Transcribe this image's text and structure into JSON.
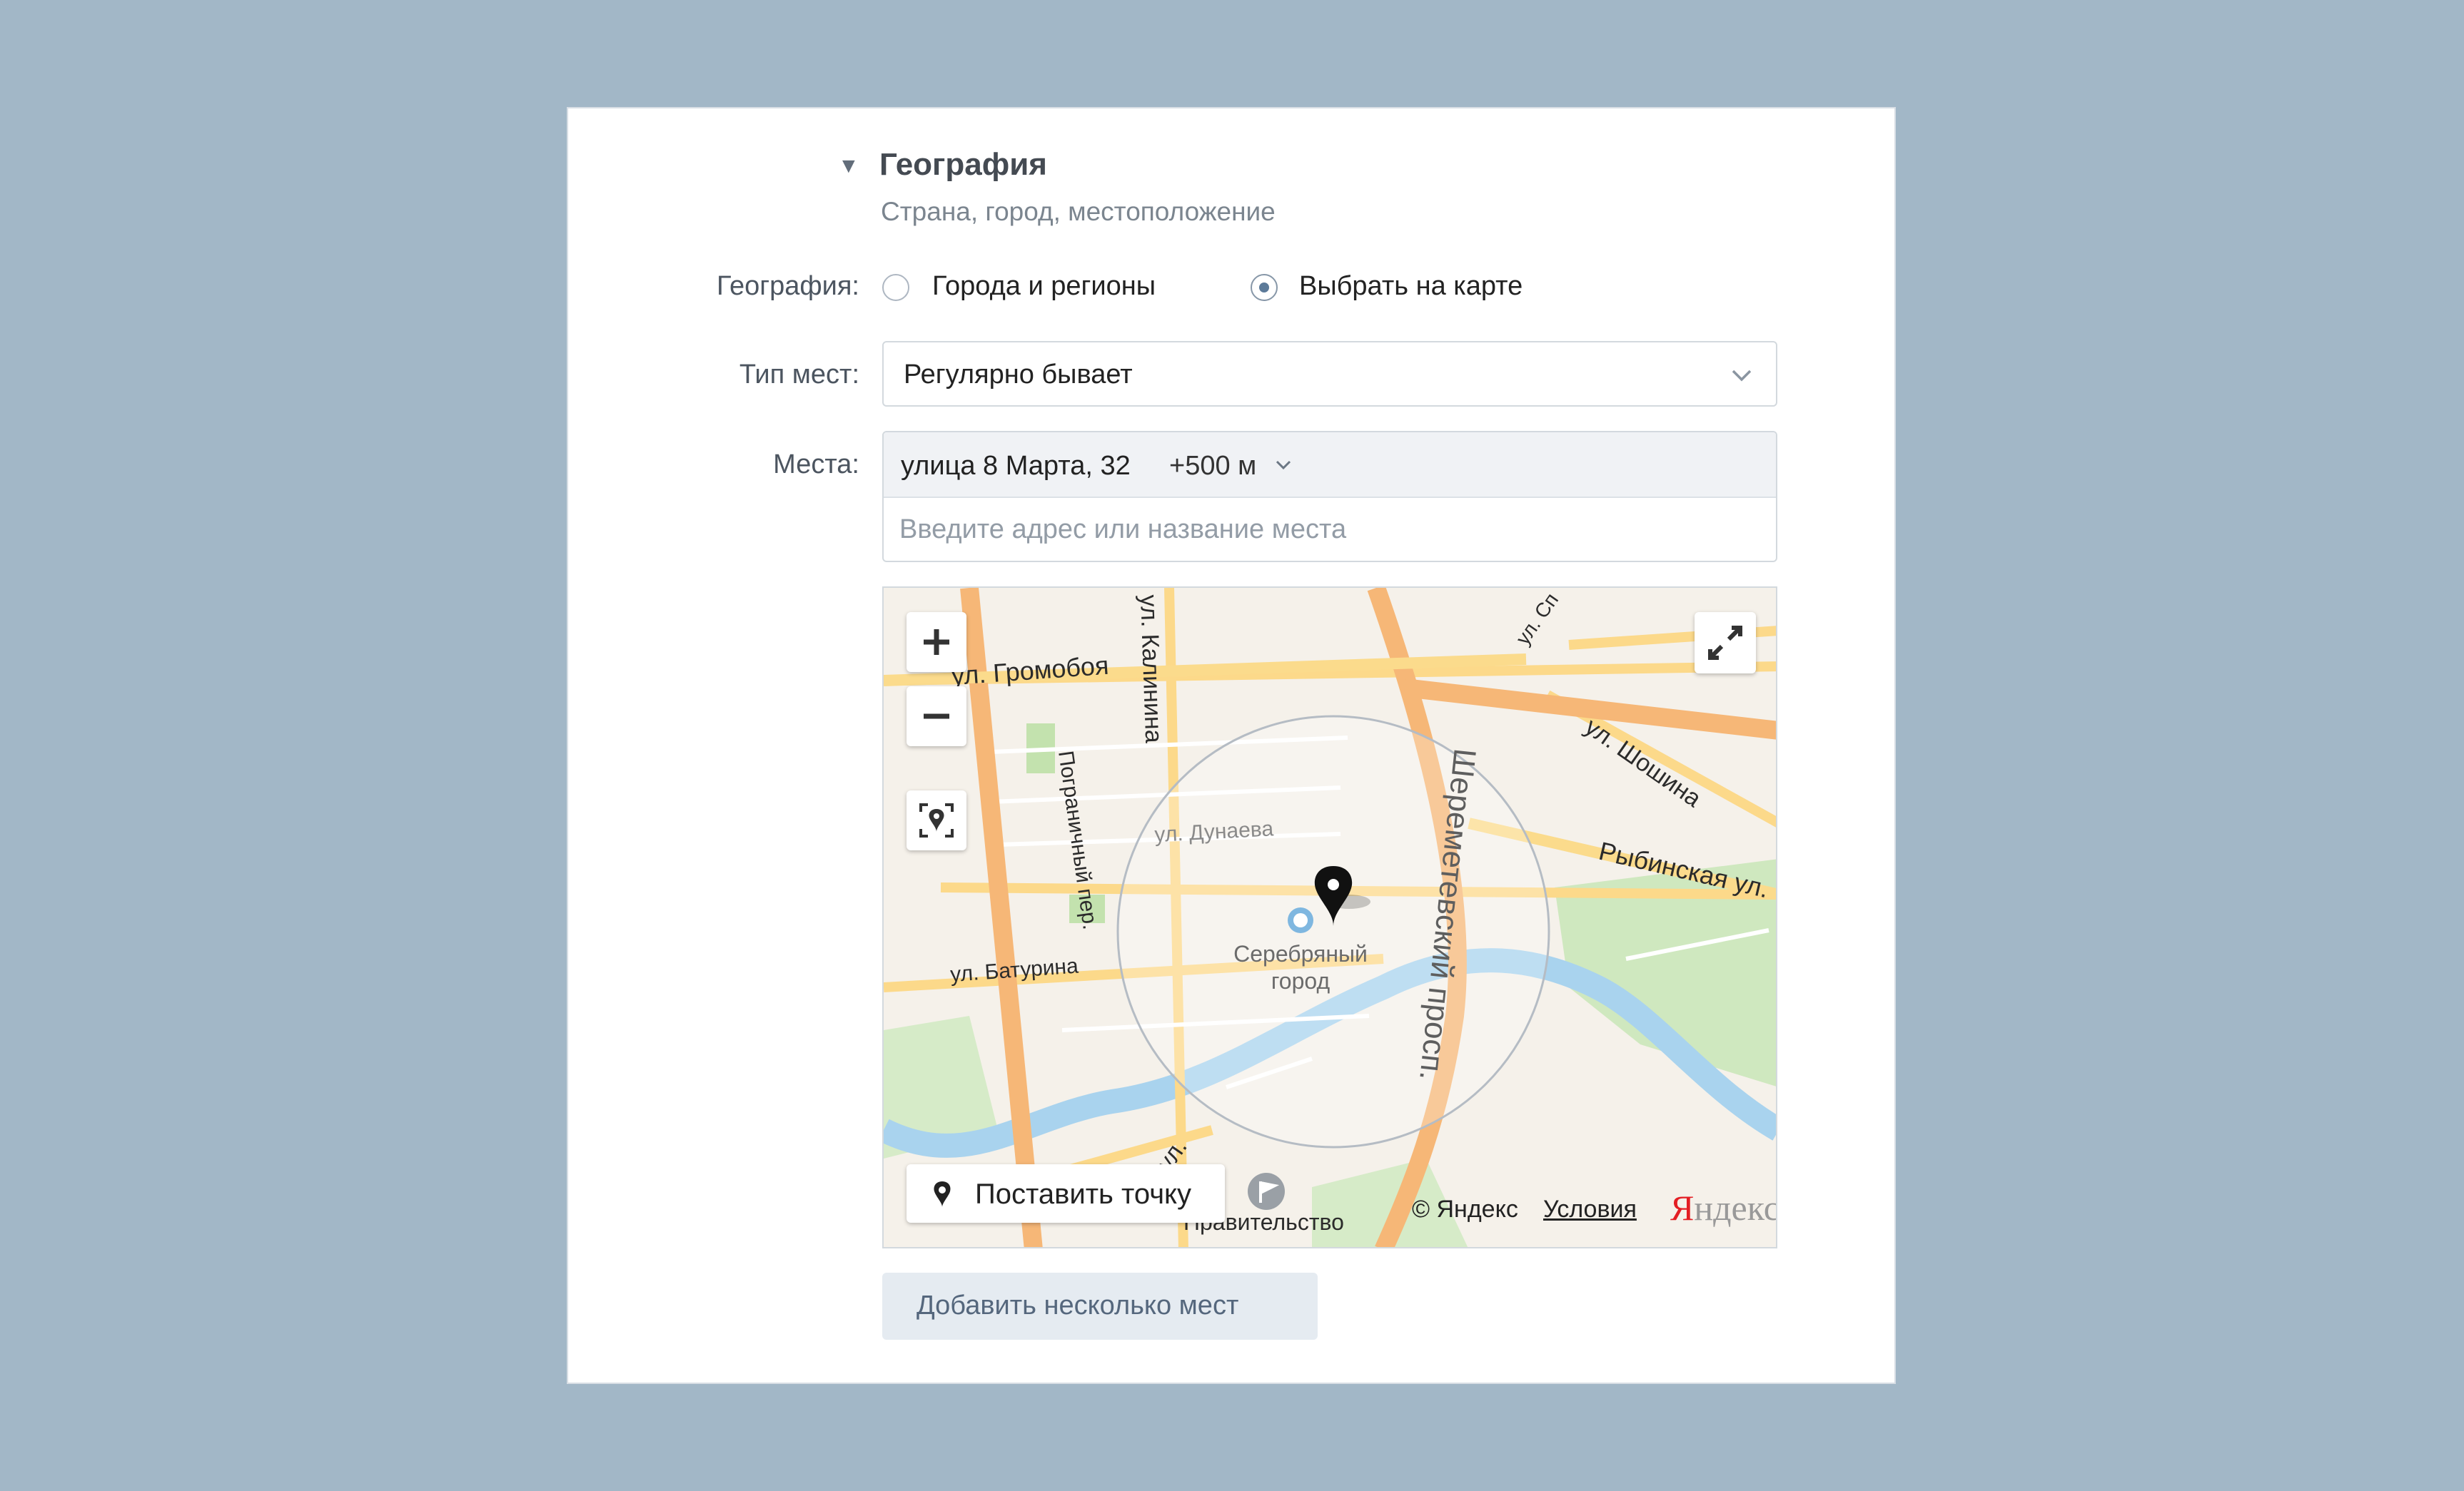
{
  "section": {
    "title": "География",
    "subtitle": "Страна, город, местоположение"
  },
  "geo": {
    "label": "География:",
    "options": [
      {
        "label": "Города и регионы",
        "selected": false
      },
      {
        "label": "Выбрать на карте",
        "selected": true
      }
    ]
  },
  "place_type": {
    "label": "Тип мест:",
    "value": "Регулярно бывает"
  },
  "places": {
    "label": "Места:",
    "token_address": "улица 8 Марта, 32",
    "token_radius": "+500 м",
    "input_value": "",
    "placeholder": "Введите адрес или название места"
  },
  "map": {
    "streets": [
      "ул. Громобоя",
      "ул. Калинина",
      "Пограничный пер.",
      "ул. Дунаева",
      "ул. Батурина",
      "Шереметевский просп.",
      "Рыбинская ул.",
      "ул. Шошина",
      "ул. Сп",
      "ул.",
      "Правительство"
    ],
    "poi_name": "Серебряный\nгород",
    "set_point_label": "Поставить точку",
    "copyright": "© Яндекс",
    "terms_link": "Условия",
    "logo_first_letter": "Я",
    "logo_rest": "ндекс"
  },
  "add_button": {
    "label": "Добавить несколько мест"
  },
  "colors": {
    "background": "#a2b7c7",
    "road_major": "#f7b97a",
    "road_minor": "#fbdb8c",
    "park": "#c8e6b4",
    "river": "#a9d3ee",
    "radius_circle": "#b5bcc4",
    "button_bg": "#e5ebf1"
  }
}
